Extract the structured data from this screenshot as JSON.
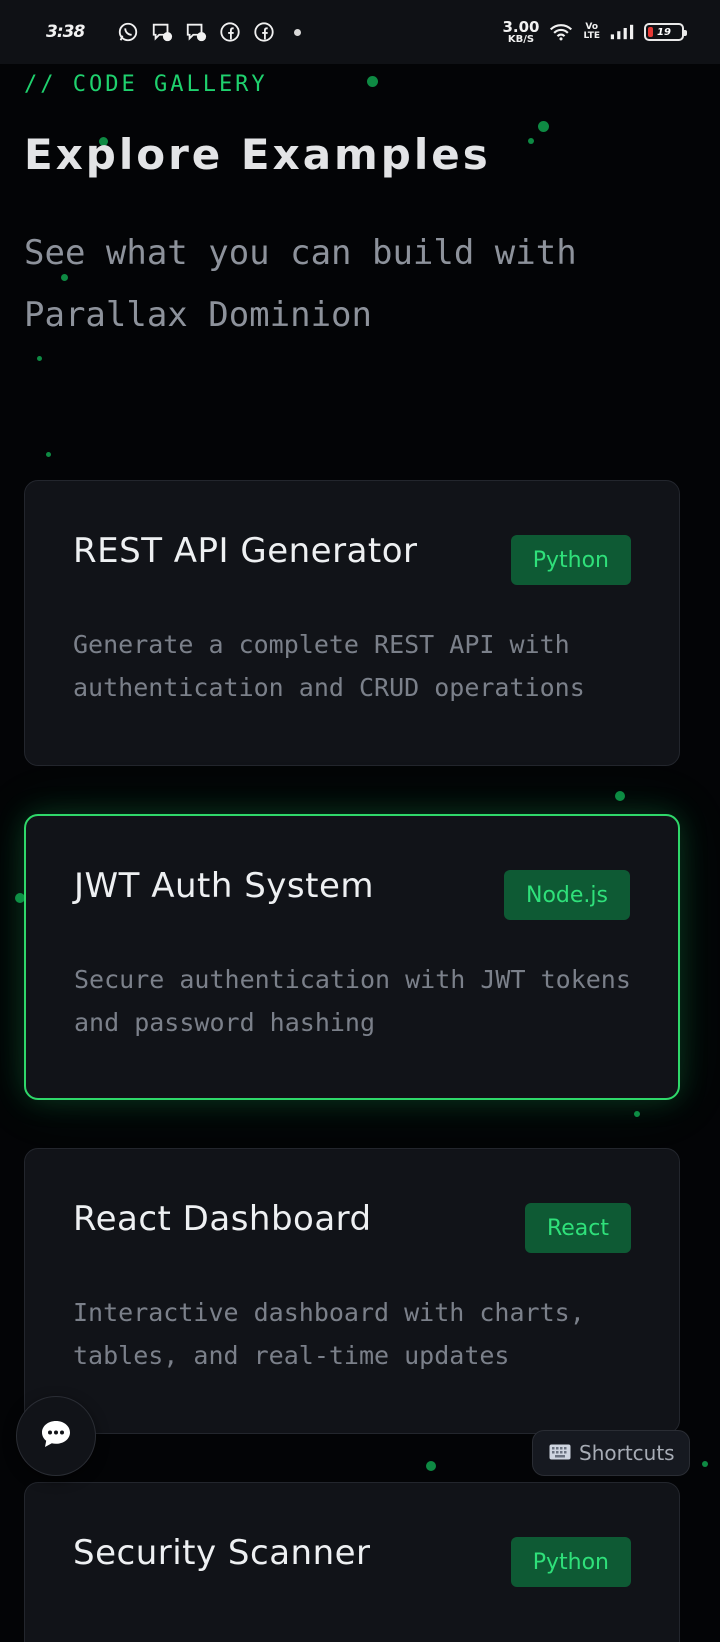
{
  "status_bar": {
    "time": "3:38",
    "net_speed_value": "3.00",
    "net_speed_unit": "KB/S",
    "volte_top": "Vo",
    "volte_bottom": "LTE",
    "battery_percent": "19",
    "battery_level": 0.19,
    "icons": [
      "whatsapp-icon",
      "messenger-icon",
      "messenger-icon",
      "facebook-icon",
      "facebook-icon",
      "dot-icon",
      "wifi-icon",
      "signal-icon",
      "battery-icon"
    ]
  },
  "header": {
    "eyebrow": "// CODE GALLERY",
    "title": "Explore Examples",
    "subtitle": "See what you can build with Parallax Dominion"
  },
  "examples": [
    {
      "title": "REST API Generator",
      "badge": "Python",
      "description": "Generate a complete REST API with authentication and CRUD operations"
    },
    {
      "title": "JWT Auth System",
      "badge": "Node.js",
      "description": "Secure authentication with JWT tokens and password hashing"
    },
    {
      "title": "React Dashboard",
      "badge": "React",
      "description": "Interactive dashboard with charts, tables, and real-time updates"
    },
    {
      "title": "Security Scanner",
      "badge": "Python",
      "description": ""
    }
  ],
  "floating": {
    "chat_icon": "chat-bubble-icon",
    "shortcuts_icon": "keyboard-icon",
    "shortcuts_label": "Shortcuts"
  },
  "colors": {
    "background": "#030406",
    "accent": "#1fd16e",
    "card": "#111318",
    "badge_bg": "#0e5a34",
    "active_border": "#2fd86a"
  }
}
